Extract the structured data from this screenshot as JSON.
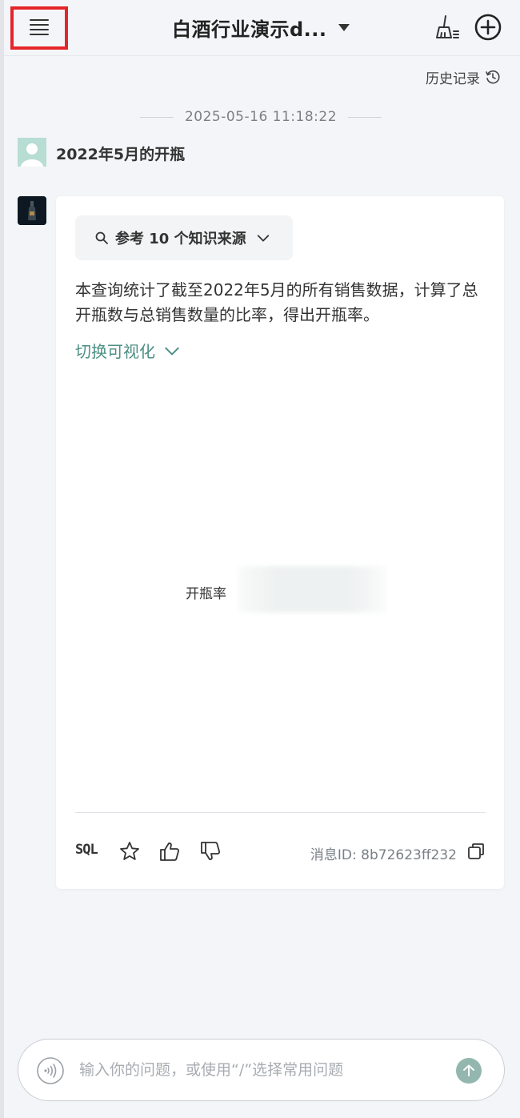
{
  "header": {
    "menu_icon": "list-menu-icon",
    "title": "白酒行业演示d...",
    "clear_icon": "broom-icon",
    "new_icon": "plus-circle-icon"
  },
  "history": {
    "label": "历史记录",
    "icon": "history-clock-icon"
  },
  "conversation": {
    "timestamp": "2025-05-16 11:18:22",
    "user_message": "2022年5月的开瓶",
    "bot": {
      "refs_label": "参考 10 个知识来源",
      "answer": "本查询统计了截至2022年5月的所有销售数据，计算了总开瓶数与总销售数量的比率，得出开瓶率。",
      "viz_toggle": "切换可视化",
      "metric_label": "开瓶率",
      "sql_label": "SQL",
      "message_id": "消息ID: 8b72623ff232"
    }
  },
  "input": {
    "placeholder": "输入你的问题，或使用“/”选择常用问题"
  },
  "colors": {
    "accent": "#4d8f85",
    "highlight_box": "#e5252a",
    "send_button": "#93b7ae",
    "user_avatar": "#b8ddd3"
  }
}
